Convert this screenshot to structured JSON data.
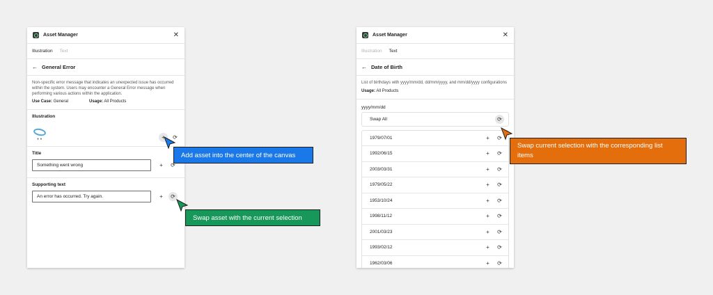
{
  "colors": {
    "tooltip_blue": "#1a78e8",
    "tooltip_green": "#17985a",
    "tooltip_orange": "#e46e0c"
  },
  "left_panel": {
    "app_title": "Asset Manager",
    "tabs": [
      {
        "label": "Illustration",
        "active": true
      },
      {
        "label": "Text",
        "active": false
      }
    ],
    "back_title": "General Error",
    "description": "Non-specific error message that indicates an unexpected issue has occurred within the system. Users may encounter a General Error message when performing various actions within the application.",
    "use_case_label": "Use Case:",
    "use_case_value": "General",
    "usage_label": "Usage:",
    "usage_value": "All Products",
    "illustration_label": "Illustration",
    "title_label": "Title",
    "title_value": "Something went wrong",
    "supporting_label": "Supporting text",
    "supporting_value": "An error has occurred. Try again."
  },
  "right_panel": {
    "app_title": "Asset Manager",
    "tabs": [
      {
        "label": "Illustration",
        "active": false
      },
      {
        "label": "Text",
        "active": true
      }
    ],
    "back_title": "Date of Birth",
    "description": "List of birthdays with yyyy/mm/dd, dd/mm/yyyy, and mm/dd/yyyy configurations",
    "usage_label": "Usage:",
    "usage_value": "All Products",
    "group_label": "yyyy/mm/dd",
    "swap_all_label": "Swap All",
    "items": [
      "1979/07/01",
      "1992/06/15",
      "2003/03/31",
      "1979/05/22",
      "1953/10/24",
      "1998/11/12",
      "2001/03/23",
      "1993/02/12",
      "1962/03/06"
    ]
  },
  "tooltips": {
    "add": "Add asset into the center of the canvas",
    "swap": "Swap asset with the current selection",
    "swap_list": "Swap current selection with the corresponding list items"
  },
  "icons": {
    "plus": "+",
    "swap": "⟳",
    "close": "✕",
    "back": "←"
  }
}
